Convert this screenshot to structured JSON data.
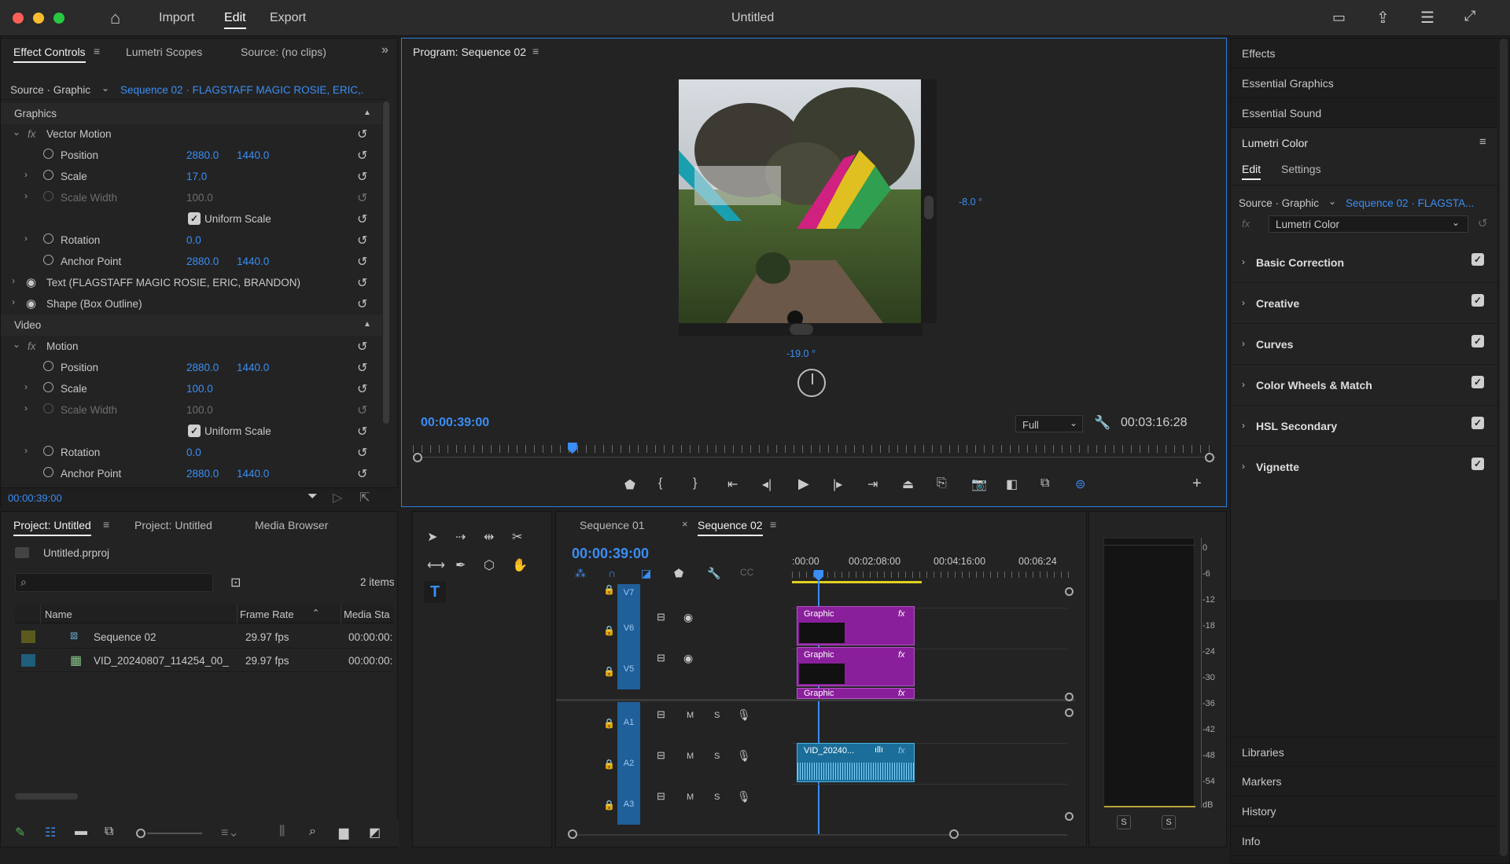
{
  "app": {
    "title": "Untitled",
    "menu": [
      "Import",
      "Edit",
      "Export"
    ],
    "active_menu": "Edit"
  },
  "effect_controls": {
    "tabs": [
      "Effect Controls",
      "Lumetri Scopes",
      "Source: (no clips)"
    ],
    "source_label": "Source · Graphic",
    "sequence_label": "Sequence 02 · FLAGSTAFF  MAGIC ROSIE, ERIC,...",
    "section_graphics": "Graphics",
    "vector_motion": "Vector Motion",
    "position": "Position",
    "scale": "Scale",
    "scale_width": "Scale Width",
    "uniform_scale": "Uniform Scale",
    "rotation": "Rotation",
    "anchor_point": "Anchor Point",
    "vm_pos_x": "2880.0",
    "vm_pos_y": "1440.0",
    "vm_scale": "17.0",
    "vm_scale_width": "100.0",
    "vm_rotation": "0.0",
    "vm_anchor_x": "2880.0",
    "vm_anchor_y": "1440.0",
    "text_layer": "Text (FLAGSTAFF  MAGIC ROSIE, ERIC, BRANDON)",
    "shape_layer": "Shape (Box Outline)",
    "section_video": "Video",
    "motion": "Motion",
    "m_pos_x": "2880.0",
    "m_pos_y": "1440.0",
    "m_scale": "100.0",
    "m_scale_width": "100.0",
    "m_rotation": "0.0",
    "m_anchor_x": "2880.0",
    "m_anchor_y": "1440.0",
    "timecode": "00:00:39:00"
  },
  "program": {
    "title": "Program: Sequence 02",
    "rot_vertical": "-8.0 °",
    "rot_horizontal": "-19.0 °",
    "timecode": "00:00:39:00",
    "quality": "Full",
    "duration": "00:03:16:28",
    "playhead_fraction": 0.2
  },
  "project": {
    "tabs": [
      "Project: Untitled",
      "Project: Untitled",
      "Media Browser"
    ],
    "file": "Untitled.prproj",
    "item_count": "2 items",
    "columns": [
      "Name",
      "Frame Rate",
      "Media Sta"
    ],
    "rows": [
      {
        "name": "Sequence 02",
        "fps": "29.97 fps",
        "start": "00:00:00:",
        "color": "#5a5a1e"
      },
      {
        "name": "VID_20240807_114254_00_",
        "fps": "29.97 fps",
        "start": "00:00:00:",
        "color": "#1e5e7a"
      }
    ]
  },
  "timeline": {
    "tabs": [
      "Sequence 01",
      "Sequence 02"
    ],
    "timecode": "00:00:39:00",
    "ruler": [
      ":00:00",
      "00:02:08:00",
      "00:04:16:00",
      "00:06:24"
    ],
    "video_tracks": [
      "V7",
      "V6",
      "V5"
    ],
    "audio_tracks": [
      "A1",
      "A2",
      "A3"
    ],
    "clip_graphic": "Graphic",
    "clip_video": "VID_20240...",
    "fx": "fx",
    "m": "M",
    "s": "S"
  },
  "meter": {
    "labels": [
      "0",
      "-6",
      "-12",
      "-18",
      "-24",
      "-30",
      "-36",
      "-42",
      "-48",
      "-54",
      "dB"
    ],
    "solo": [
      "S",
      "S"
    ]
  },
  "right_panel": {
    "top_items": [
      "Effects",
      "Essential Graphics",
      "Essential Sound"
    ],
    "lumetri_title": "Lumetri Color",
    "lumetri_tabs": [
      "Edit",
      "Settings"
    ],
    "source_label": "Source · Graphic",
    "sequence_label": "Sequence 02 · FLAGSTA...",
    "effect_name": "Lumetri Color",
    "sections": [
      "Basic Correction",
      "Creative",
      "Curves",
      "Color Wheels & Match",
      "HSL Secondary",
      "Vignette"
    ],
    "bottom_items": [
      "Libraries",
      "Markers",
      "History",
      "Info"
    ]
  }
}
